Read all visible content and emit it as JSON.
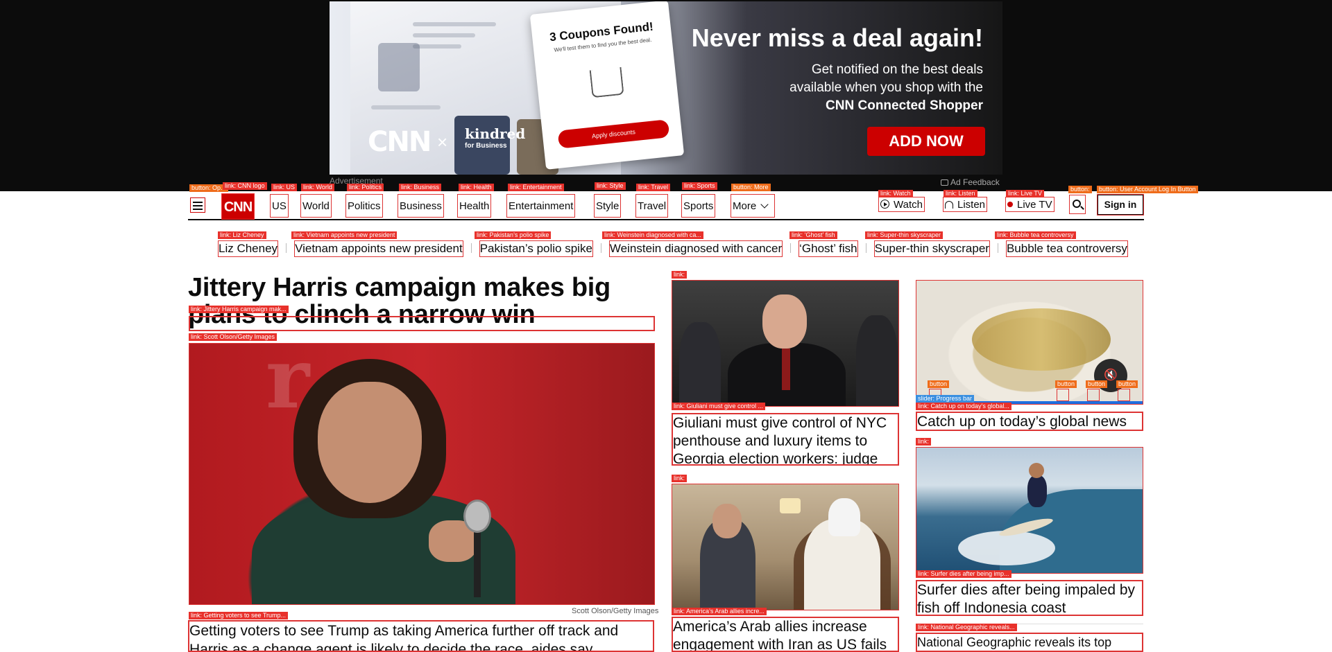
{
  "ad": {
    "headline": "Never miss a deal again!",
    "body_line1": "Get notified on the best deals",
    "body_line2": "available when you shop with the",
    "body_bold": "CNN Connected Shopper",
    "cta": "ADD NOW",
    "popup_title": "3 Coupons Found!",
    "popup_sub": "We'll test them to find you the best deal.",
    "popup_button": "Apply discounts",
    "brand_a": "CNN",
    "brand_b": "kindred",
    "brand_b_sub": "for Business",
    "label": "Advertisement",
    "feedback": "Ad Feedback"
  },
  "nav": {
    "logo": "CNN",
    "items": [
      "US",
      "World",
      "Politics",
      "Business",
      "Health",
      "Entertainment",
      "Style",
      "Travel",
      "Sports",
      "More"
    ],
    "watch": "Watch",
    "listen": "Listen",
    "live_tv": "Live TV",
    "sign_in": "Sign in"
  },
  "trending": [
    "Liz Cheney",
    "Vietnam appoints new president",
    "Pakistan’s polio spike",
    "Weinstein diagnosed with cancer",
    "‘Ghost’ fish",
    "Super-thin skyscraper",
    "Bubble tea controversy"
  ],
  "lead": {
    "title": "Jittery Harris campaign makes big plans to clinch a narrow win",
    "credit": "Scott Olson/Getty Images",
    "subheadline": "Getting voters to see Trump as taking America further off track and Harris as a change agent is likely to decide the race, aides say"
  },
  "cards": {
    "giuliani": "Giuliani must give control of NYC penthouse and luxury items to Georgia election workers: judge",
    "catchup": "Catch up on today’s global news",
    "arab": "America’s Arab allies increase engagement with Iran as US fails",
    "surfer": "Surfer dies after being impaled by fish off Indonesia coast",
    "natgeo": "National Geographic reveals its top"
  },
  "overlay_tags": {
    "hamburger": "button: Op...",
    "logo": "link: CNN logo",
    "us": "link: US",
    "world": "link: World",
    "politics": "link: Politics",
    "business": "link: Business",
    "health": "link: Health",
    "entertainment": "link: Entertainment",
    "style": "link: Style",
    "travel": "link: Travel",
    "sports": "link: Sports",
    "more": "button: More",
    "watch": "link: Watch",
    "listen": "link: Listen",
    "live_tv": "link: Live TV",
    "search": "button:",
    "account": "button: User Account Log In Button",
    "trending": [
      "link: Liz Cheney",
      "link: Vietnam appoints new president",
      "link: Pakistan’s polio spike",
      "link: Weinstein diagnosed with ca...",
      "link: ‘Ghost’ fish",
      "link: Super-thin skyscraper",
      "link: Bubble tea controversy"
    ],
    "lead_title": "link: Jittery Harris campaign mak...",
    "lead_image": "link: Scott Olson/Getty Images",
    "lead_sub": "link: Getting voters to see Trump...",
    "giuliani_img": "link:",
    "giuliani": "link: Giuliani must give control ...",
    "catchup_btn": "button",
    "progress": "slider: Progress bar",
    "catchup": "link: Catch up on today’s global...",
    "arab_img": "link:",
    "arab": "link: America’s Arab allies incre...",
    "surfer_img": "link:",
    "surfer": "link: Surfer dies after being imp...",
    "natgeo": "link: National Geographic reveals..."
  }
}
